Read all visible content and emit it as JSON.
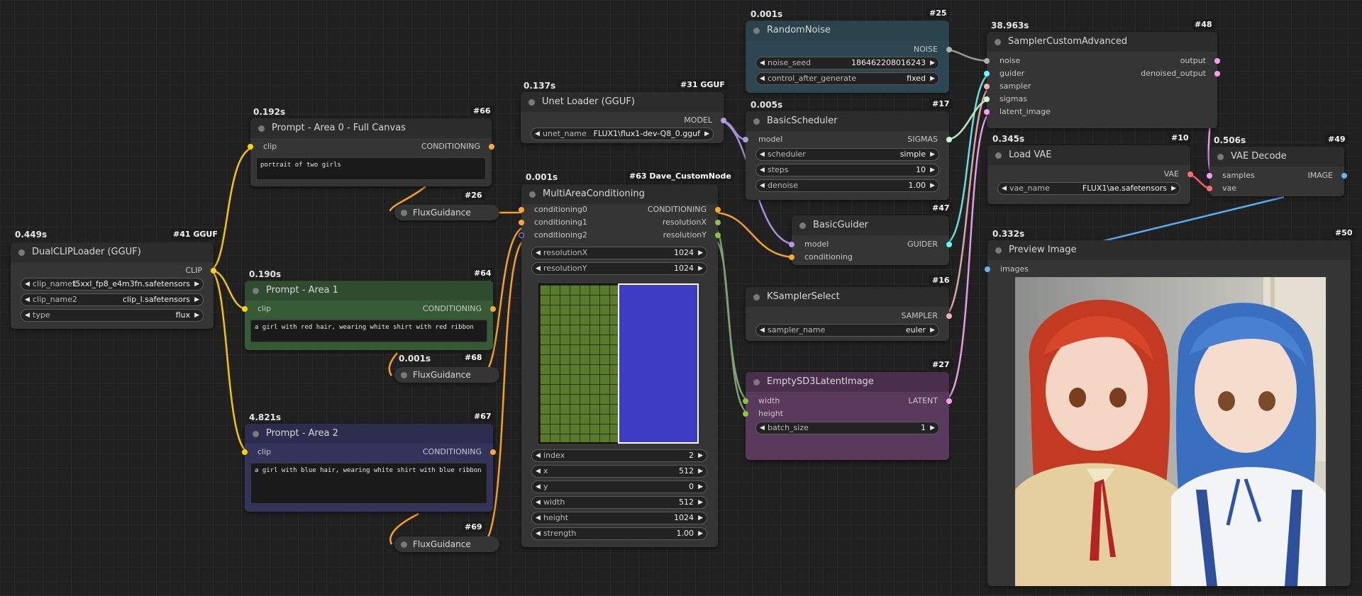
{
  "nodes": {
    "dualclip": {
      "time": "0.449s",
      "id": "#41 GGUF",
      "title": "DualCLIPLoader (GGUF)",
      "out": "CLIP",
      "clip_name1": {
        "label": "clip_name1",
        "value": "t5xxl_fp8_e4m3fn.safetensors"
      },
      "clip_name2": {
        "label": "clip_name2",
        "value": "clip_l.safetensors"
      },
      "type": {
        "label": "type",
        "value": "flux"
      }
    },
    "prompt0": {
      "time": "0.192s",
      "id": "#66",
      "title": "Prompt - Area 0 - Full Canvas",
      "in": "clip",
      "out": "CONDITIONING",
      "text": "portrait of two girls"
    },
    "prompt1": {
      "time": "0.190s",
      "id": "#64",
      "title": "Prompt - Area 1",
      "in": "clip",
      "out": "CONDITIONING",
      "text": "a girl with red hair, wearing white shirt with red ribbon"
    },
    "prompt2": {
      "time": "4.821s",
      "id": "#67",
      "title": "Prompt - Area 2",
      "in": "clip",
      "out": "CONDITIONING",
      "text": "a girl with blue hair, wearing white shirt with blue ribbon"
    },
    "flux26": {
      "id": "#26",
      "title": "FluxGuidance"
    },
    "flux68": {
      "time": "0.001s",
      "id": "#68",
      "title": "FluxGuidance"
    },
    "flux69": {
      "id": "#69",
      "title": "FluxGuidance"
    },
    "unet": {
      "time": "0.137s",
      "id": "#31 GGUF",
      "title": "Unet Loader (GGUF)",
      "out": "MODEL",
      "unet_name": {
        "label": "unet_name",
        "value": "FLUX1\\flux1-dev-Q8_0.gguf"
      }
    },
    "mac": {
      "time": "0.001s",
      "id": "#63 Dave_CustomNode",
      "title": "MultiAreaConditioning",
      "inputs": [
        "conditioning0",
        "conditioning1",
        "conditioning2"
      ],
      "outputs": [
        "CONDITIONING",
        "resolutionX",
        "resolutionY"
      ],
      "widgets": [
        {
          "label": "resolutionX",
          "value": "1024"
        },
        {
          "label": "resolutionY",
          "value": "1024"
        }
      ],
      "widgets2": [
        {
          "label": "index",
          "value": "2"
        },
        {
          "label": "x",
          "value": "512"
        },
        {
          "label": "y",
          "value": "0"
        },
        {
          "label": "width",
          "value": "512"
        },
        {
          "label": "height",
          "value": "1024"
        },
        {
          "label": "strength",
          "value": "1.00"
        }
      ],
      "area_colors": {
        "green": "#5a7a2e",
        "blue": "#3d3dc4"
      }
    },
    "noise": {
      "time": "0.001s",
      "id": "#25",
      "title": "RandomNoise",
      "out": "NOISE",
      "noise_seed": {
        "label": "noise_seed",
        "value": "186462208016243"
      },
      "control": {
        "label": "control_after_generate",
        "value": "fixed"
      }
    },
    "sched": {
      "time": "0.005s",
      "id": "#17",
      "title": "BasicScheduler",
      "in": "model",
      "out": "SIGMAS",
      "scheduler": {
        "label": "scheduler",
        "value": "simple"
      },
      "steps": {
        "label": "steps",
        "value": "10"
      },
      "denoise": {
        "label": "denoise",
        "value": "1.00"
      }
    },
    "guider": {
      "id": "#47",
      "title": "BasicGuider",
      "in1": "model",
      "in2": "conditioning",
      "out": "GUIDER"
    },
    "ksel": {
      "id": "#16",
      "title": "KSamplerSelect",
      "out": "SAMPLER",
      "sampler": {
        "label": "sampler_name",
        "value": "euler"
      }
    },
    "latent": {
      "id": "#27",
      "title": "EmptySD3LatentImage",
      "in1": "width",
      "in2": "height",
      "out": "LATENT",
      "batch": {
        "label": "batch_size",
        "value": "1"
      }
    },
    "sca": {
      "time": "38.963s",
      "id": "#48",
      "title": "SamplerCustomAdvanced",
      "inputs": [
        "noise",
        "guider",
        "sampler",
        "sigmas",
        "latent_image"
      ],
      "outputs": [
        "output",
        "denoised_output"
      ]
    },
    "vae": {
      "time": "0.345s",
      "id": "#10",
      "title": "Load VAE",
      "out": "VAE",
      "vae_name": {
        "label": "vae_name",
        "value": "FLUX1\\ae.safetensors"
      }
    },
    "decode": {
      "time": "0.506s",
      "id": "#49",
      "title": "VAE Decode",
      "in1": "samples",
      "in2": "vae",
      "out": "IMAGE"
    },
    "preview": {
      "time": "0.332s",
      "id": "#50",
      "title": "Preview Image",
      "in": "images"
    }
  },
  "colors": {
    "clip": "#ffd500",
    "cond": "#ffa931",
    "model": "#b39ddb",
    "vae": "#ff6e6e",
    "latent": "#ff9cf9",
    "image": "#64b5f6",
    "noise": "#b0b0b0",
    "int": "#8bc34a",
    "sampler": "#ecb4b4",
    "guider": "#66ffff",
    "sigmas": "#cdffcd"
  }
}
